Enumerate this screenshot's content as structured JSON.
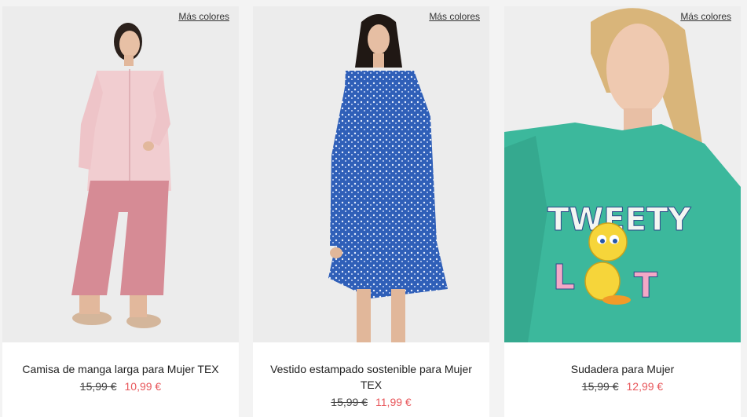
{
  "products": [
    {
      "more_colors": "Más colores",
      "title": "Camisa de manga larga para Mujer TEX",
      "old_price": "15,99 €",
      "new_price": "10,99 €"
    },
    {
      "more_colors": "Más colores",
      "title": "Vestido estampado sostenible para Mujer TEX",
      "old_price": "15,99 €",
      "new_price": "11,99 €"
    },
    {
      "more_colors": "Más colores",
      "title": "Sudadera para Mujer",
      "old_price": "15,99 €",
      "new_price": "12,99 €"
    }
  ],
  "colors": {
    "sale_price": "#e8575b",
    "card_bg": "#ffffff",
    "page_bg": "#f3f3f3"
  }
}
